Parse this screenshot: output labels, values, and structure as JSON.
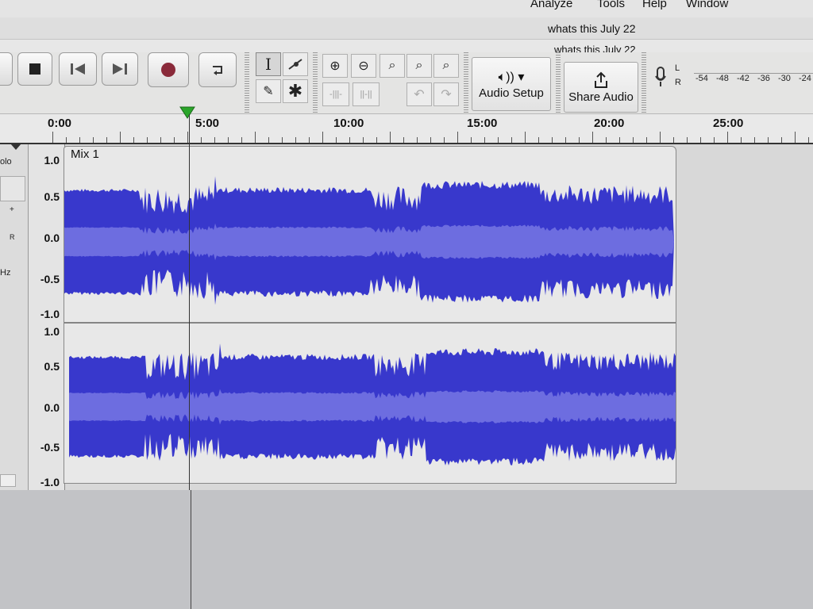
{
  "menu": {
    "items": [
      "Analyze",
      "Tools",
      "Help",
      "Window"
    ]
  },
  "window": {
    "title": "whats this July 22",
    "tab_title": "whats this July 22"
  },
  "toolbar": {
    "audio_setup_label": "Audio Setup",
    "share_audio_label": "Share Audio",
    "meter_channels": [
      "L",
      "R"
    ],
    "meter_scale": [
      "-54",
      "-48",
      "-42",
      "-36",
      "-30",
      "-24"
    ]
  },
  "timeline": {
    "labels": [
      "0:00",
      "5:00",
      "10:00",
      "15:00",
      "20:00",
      "25:00"
    ],
    "playhead_time": "4:58"
  },
  "track": {
    "name": "Mix 1",
    "control_labels": [
      "olo",
      "+",
      "R",
      "Hz"
    ],
    "scale_labels": [
      "1.0",
      "0.5",
      "0.0",
      "-0.5",
      "-1.0"
    ]
  },
  "colors": {
    "waveform": "#3838cc",
    "waveform_rms": "#6d6de0",
    "clip_bg": "#e8e8e8",
    "playhead": "#2aa52a"
  }
}
